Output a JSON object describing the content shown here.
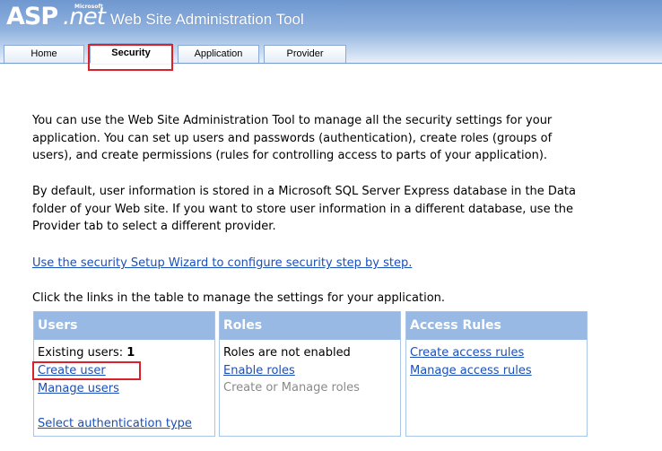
{
  "header": {
    "logo_asp": "ASP",
    "logo_net": ".net",
    "logo_microsoft": "Microsoft",
    "title": "Web Site Administration Tool"
  },
  "tabs": [
    {
      "label": "Home"
    },
    {
      "label": "Security",
      "active": true
    },
    {
      "label": "Application"
    },
    {
      "label": "Provider"
    }
  ],
  "intro": {
    "paragraph1": "You can use the Web Site Administration Tool to manage all the security settings for your application. You can set up users and passwords (authentication), create roles (groups of users), and create permissions (rules for controlling access to parts of your application).",
    "paragraph2": "By default, user information is stored in a Microsoft SQL Server Express database in the Data folder of your Web site. If you want to store user information in a different database, use the Provider tab to select a different provider.",
    "wizard_link": "Use the security Setup Wizard to configure security step by step.",
    "table_hint": "Click the links in the table to manage the settings for your application."
  },
  "users": {
    "heading": "Users",
    "existing_label": "Existing users: ",
    "existing_count": "1",
    "create_user": "Create user",
    "manage_users": "Manage users",
    "select_auth": "Select authentication type"
  },
  "roles": {
    "heading": "Roles",
    "status": "Roles are not enabled",
    "enable_roles": "Enable roles",
    "create_manage_disabled": "Create or Manage roles"
  },
  "access_rules": {
    "heading": "Access Rules",
    "create": "Create access rules",
    "manage": "Manage access rules"
  },
  "colors": {
    "link": "#1a4fb8",
    "highlight": "#d9212a",
    "grid_header": "#97b9e3"
  }
}
